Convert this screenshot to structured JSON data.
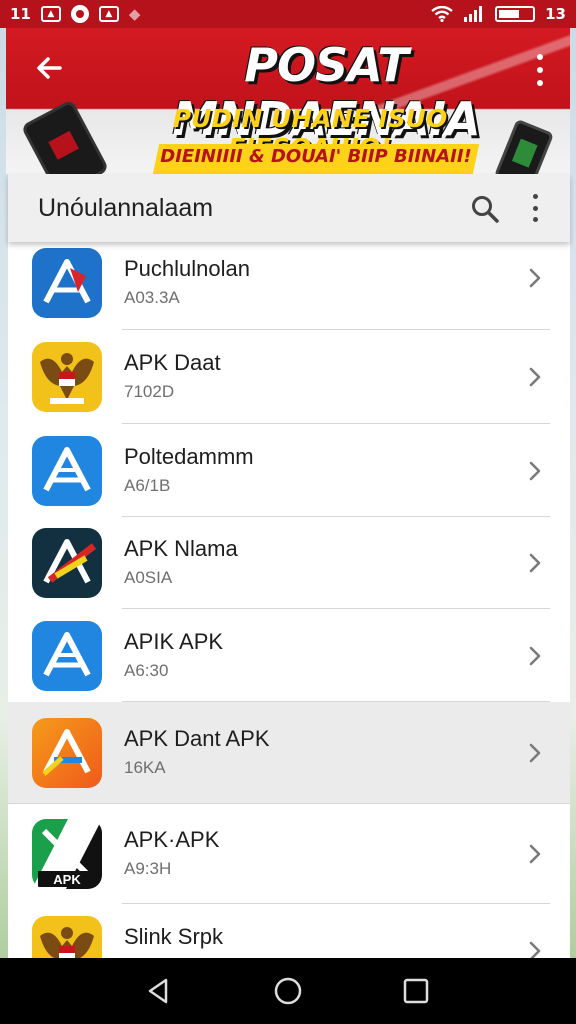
{
  "status_bar": {
    "left_text": "11",
    "right_text": "13",
    "icons": [
      "notification-icon",
      "gallery-icon",
      "circle-app-icon",
      "photo-icon",
      "wifi-icon",
      "signal-icon",
      "battery-icon"
    ]
  },
  "banner": {
    "title": "POSAT MNDAENAIA",
    "subtitle": "PUDIN UHANE ISUO FIFSOAUIO!",
    "tagline": "DIEINIIII & DOUAI' BIIP BIINAII!",
    "colors": {
      "red": "#c1121a",
      "yellow": "#ffd21a"
    }
  },
  "app_bar": {
    "title": "Unóulannalaam",
    "icons": [
      "search-icon",
      "more-vert-icon"
    ]
  },
  "list": {
    "items": [
      {
        "name": "Puchlulnolan",
        "size": "A03.3A",
        "icon": "apk-blue-red-icon",
        "highlight": false
      },
      {
        "name": "APK Daat",
        "size": "7102D",
        "icon": "garuda-emblem-icon",
        "highlight": false
      },
      {
        "name": "Poltedammm",
        "size": "A6/1B",
        "icon": "apk-blue-icon",
        "highlight": false
      },
      {
        "name": "APK Nlama",
        "size": "A0SIA",
        "icon": "apk-dark-icon",
        "highlight": false
      },
      {
        "name": "APIK APK",
        "size": "A6:30",
        "icon": "apk-blue-icon",
        "highlight": false
      },
      {
        "name": "APK Dant APK",
        "size": "16KA",
        "icon": "apk-orange-icon",
        "highlight": true
      },
      {
        "name": "APK·APK",
        "size": "A9:3H",
        "icon": "apk-green-icon",
        "highlight": false
      },
      {
        "name": "Slink Srpk",
        "size": "",
        "icon": "garuda-emblem-icon",
        "highlight": false
      }
    ],
    "apk_label": "APK"
  },
  "nav_bar": {
    "icons": [
      "back-triangle-icon",
      "home-circle-icon",
      "recents-square-icon"
    ]
  }
}
